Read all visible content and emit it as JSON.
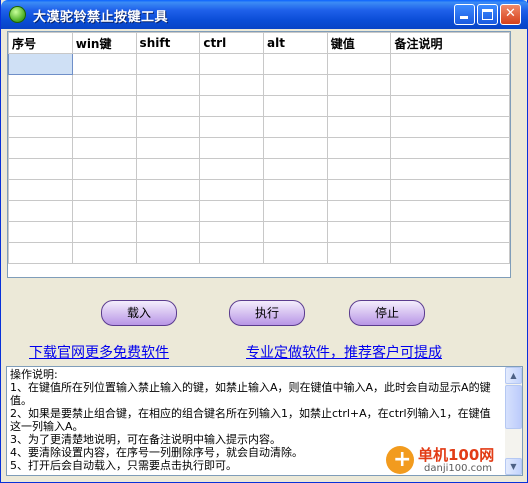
{
  "window": {
    "title": "大漠驼铃禁止按键工具",
    "title_bar_color": "#0a4dd6",
    "close_color": "#d6401b"
  },
  "grid": {
    "columns": [
      "序号",
      "win键",
      "shift",
      "ctrl",
      "alt",
      "键值",
      "备注说明"
    ],
    "rows": [
      [
        "",
        "",
        "",
        "",
        "",
        "",
        ""
      ],
      [
        "",
        "",
        "",
        "",
        "",
        "",
        ""
      ],
      [
        "",
        "",
        "",
        "",
        "",
        "",
        ""
      ],
      [
        "",
        "",
        "",
        "",
        "",
        "",
        ""
      ],
      [
        "",
        "",
        "",
        "",
        "",
        "",
        ""
      ],
      [
        "",
        "",
        "",
        "",
        "",
        "",
        ""
      ],
      [
        "",
        "",
        "",
        "",
        "",
        "",
        ""
      ],
      [
        "",
        "",
        "",
        "",
        "",
        "",
        ""
      ],
      [
        "",
        "",
        "",
        "",
        "",
        "",
        ""
      ],
      [
        "",
        "",
        "",
        "",
        "",
        "",
        ""
      ]
    ],
    "selected_cell": "row 1, column 序号"
  },
  "buttons": {
    "load": "载入",
    "execute": "执行",
    "stop": "停止",
    "color": "#b896e6"
  },
  "links": {
    "download": "下载官网更多免费软件",
    "custom": "专业定做软件，推荐客户可提成"
  },
  "notes": {
    "lines": [
      "操作说明:",
      "1、在键值所在列位置输入禁止输入的键，如禁止输入A，则在键值中输入A，此时会自动显示A的键值。",
      "2、如果是要禁止组合键，在相应的组合键名所在列输入1，如禁止ctrl+A，在ctrl列输入1，在键值这一列输入A。",
      "3、为了更清楚地说明，可在备注说明中输入提示内容。",
      "4、要清除设置内容，在序号一列删除序号，就会自动清除。",
      "5、打开后会自动载入，只需要点击执行即可。"
    ]
  },
  "watermark": {
    "name": "单机100网",
    "url": "danji100.com",
    "color": "#e23c16"
  },
  "icons": {
    "app": "app-icon",
    "minimize": "minimize-icon",
    "maximize": "maximize-icon",
    "close": "close-icon",
    "scroll_up": "scroll-up-icon",
    "scroll_down": "scroll-down-icon"
  }
}
